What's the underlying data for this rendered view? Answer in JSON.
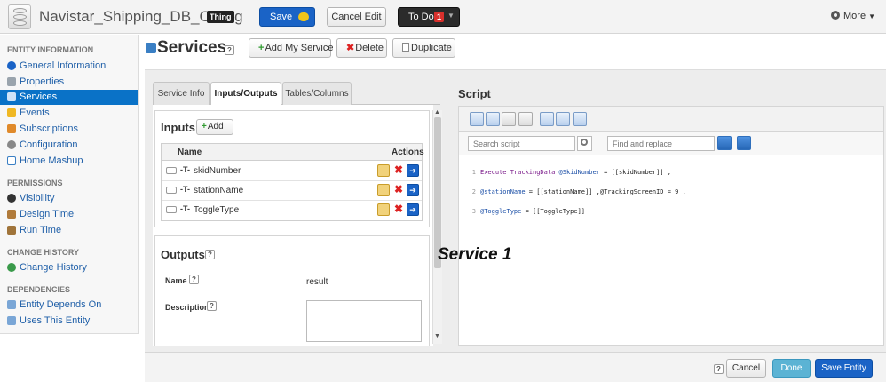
{
  "header": {
    "title": "Navistar_Shipping_DB_Config",
    "badge": "Thing",
    "save_label": "Save",
    "cancel_edit_label": "Cancel Edit",
    "todo_label": "To Do",
    "todo_count": "1",
    "more_label": "More"
  },
  "sidebar": {
    "sections": [
      "ENTITY INFORMATION",
      "PERMISSIONS",
      "CHANGE HISTORY",
      "DEPENDENCIES"
    ],
    "entity_items": [
      {
        "label": "General Information",
        "icon": "info-icon"
      },
      {
        "label": "Properties",
        "icon": "properties-icon"
      },
      {
        "label": "Services",
        "icon": "services-icon",
        "active": true
      },
      {
        "label": "Events",
        "icon": "lightning-icon"
      },
      {
        "label": "Subscriptions",
        "icon": "subscriptions-icon"
      },
      {
        "label": "Configuration",
        "icon": "gear-icon"
      },
      {
        "label": "Home Mashup",
        "icon": "mashup-icon"
      }
    ],
    "permission_items": [
      {
        "label": "Visibility",
        "icon": "visibility-icon"
      },
      {
        "label": "Design Time",
        "icon": "user-icon"
      },
      {
        "label": "Run Time",
        "icon": "runtime-icon"
      }
    ],
    "history_items": [
      {
        "label": "Change History",
        "icon": "history-icon"
      }
    ],
    "dependency_items": [
      {
        "label": "Entity Depends On",
        "icon": "dependency-icon"
      },
      {
        "label": "Uses This Entity",
        "icon": "dependency-icon"
      }
    ]
  },
  "page": {
    "title": "Services",
    "help": "?",
    "toolbar": {
      "add_my_service": "Add My Service",
      "delete": "Delete",
      "duplicate": "Duplicate"
    }
  },
  "tabs": [
    "Service Info",
    "Inputs/Outputs",
    "Tables/Columns"
  ],
  "inputs": {
    "title": "Inputs",
    "add_label": "Add",
    "col_name": "Name",
    "col_actions": "Actions",
    "rows": [
      {
        "type_symbol": "-T-",
        "name": "skidNumber"
      },
      {
        "type_symbol": "-T-",
        "name": "stationName"
      },
      {
        "type_symbol": "-T-",
        "name": "ToggleType"
      }
    ]
  },
  "outputs": {
    "title": "Outputs",
    "name_label": "Name",
    "name_value": "result",
    "description_label": "Description"
  },
  "script": {
    "title": "Script",
    "search_placeholder": "Search script",
    "replace_placeholder": "Find and replace",
    "lines": [
      {
        "num": "1",
        "kw": "Execute TrackingData ",
        "var": "@SkidNumber",
        "rest": " = [[skidNumber]] ,"
      },
      {
        "num": "2",
        "kw": "",
        "var": "@stationName",
        "rest": " = [[stationName]] ,@TrackingScreenID = 9 ,"
      },
      {
        "num": "3",
        "kw": "",
        "var": "@ToggleType",
        "rest": " = [[ToggleType]]"
      }
    ]
  },
  "annotation": "Service 1",
  "footer": {
    "help": "?",
    "cancel_label": "Cancel",
    "done_label": "Done",
    "save_entity_label": "Save Entity"
  },
  "colors": {
    "accent": "#1a63c6",
    "sidebar_active": "#0a72c7",
    "done": "#5bb3d4",
    "todo_count": "#d9302c"
  }
}
